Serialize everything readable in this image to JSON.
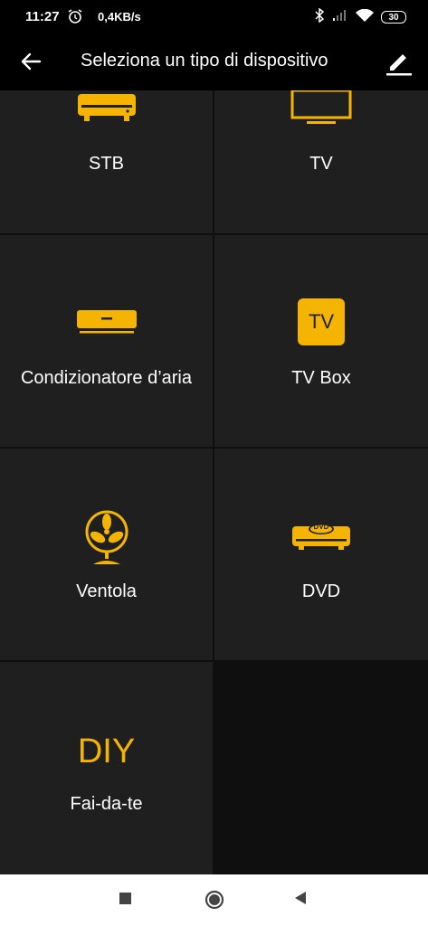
{
  "status": {
    "time": "11:27",
    "speed": "0,4KB/s",
    "battery": "30"
  },
  "header": {
    "title": "Seleziona un tipo di dispositivo"
  },
  "devices": [
    {
      "label": "STB",
      "icon": "set-top-box-icon"
    },
    {
      "label": "TV",
      "icon": "tv-icon"
    },
    {
      "label": "Condizionatore d’aria",
      "icon": "air-conditioner-icon"
    },
    {
      "label": "TV Box",
      "icon": "tv-box-icon",
      "badge": "TV"
    },
    {
      "label": "Ventola",
      "icon": "fan-icon"
    },
    {
      "label": "DVD",
      "icon": "dvd-player-icon",
      "badge": "DVD"
    },
    {
      "label": "Fai-da-te",
      "icon": "diy-icon",
      "badge": "DIY"
    }
  ],
  "colors": {
    "accent": "#F5B400",
    "cell": "#1f1f1f",
    "background": "#0f0f0f",
    "bar": "#000000"
  }
}
